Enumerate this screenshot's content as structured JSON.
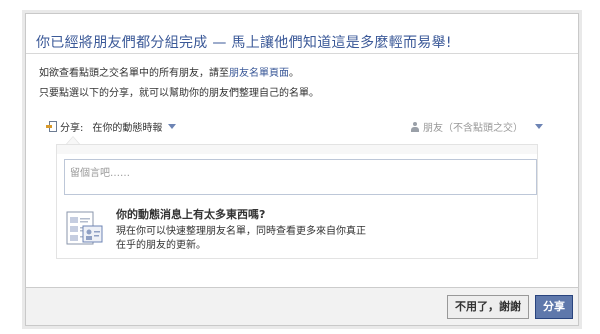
{
  "dialog": {
    "title": "你已經將朋友們都分組完成 — 馬上讓他們知道這是多麼輕而易舉!",
    "line1_prefix": "如欲查看點頭之交名單中的所有朋友，請至",
    "line1_link": "朋友名單頁面",
    "line1_suffix": "。",
    "line2": "只要點選以下的分享，就可以幫助你的朋友們整理自己的名單。"
  },
  "share": {
    "label": "分享:",
    "destination": "在你的動態時報",
    "audience": "朋友（不含點頭之交）"
  },
  "composer": {
    "placeholder": "留個言吧……"
  },
  "tip": {
    "title": "你的動態消息上有太多東西嗎?",
    "text": "現在你可以快速整理朋友名單，同時查看更多來自你真正在乎的朋友的更新。"
  },
  "buttons": {
    "cancel": "不用了，謝謝",
    "share": "分享"
  },
  "colors": {
    "brand_blue": "#3b5998",
    "share_button": "#5f78ab"
  },
  "icons": {
    "share": "share-icon",
    "audience": "friends-icon",
    "tip": "friend-list-icon",
    "dropdown": "chevron-down-icon"
  }
}
